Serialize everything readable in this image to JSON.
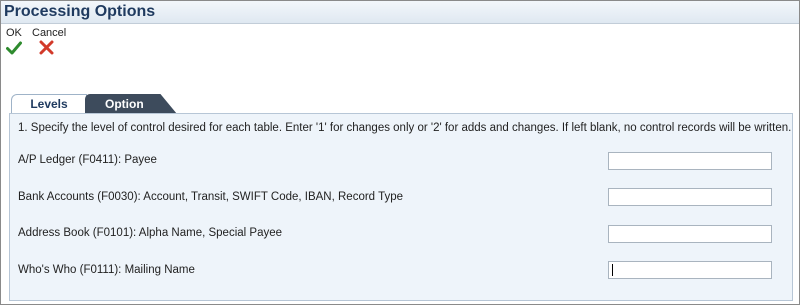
{
  "window": {
    "title": "Processing Options"
  },
  "toolbar": {
    "ok_label": "OK",
    "cancel_label": "Cancel"
  },
  "tabs": [
    {
      "label": "Levels",
      "active": true
    },
    {
      "label": "Option",
      "active": false
    }
  ],
  "instruction": "1. Specify the level of control desired for each table. Enter '1' for changes only or '2' for adds and changes. If left blank, no control records will be written.",
  "fields": [
    {
      "label": "A/P Ledger (F0411): Payee",
      "value": ""
    },
    {
      "label": "Bank Accounts (F0030): Account, Transit, SWIFT Code, IBAN, Record Type",
      "value": ""
    },
    {
      "label": "Address Book (F0101): Alpha Name, Special Payee",
      "value": ""
    },
    {
      "label": "Who's Who (F0111): Mailing Name",
      "value": ""
    }
  ],
  "icons": {
    "ok": "checkmark-icon",
    "cancel": "x-icon"
  },
  "colors": {
    "ok_icon": "#2e8b2e",
    "cancel_icon": "#d23a2a",
    "title": "#1f3a5f"
  }
}
